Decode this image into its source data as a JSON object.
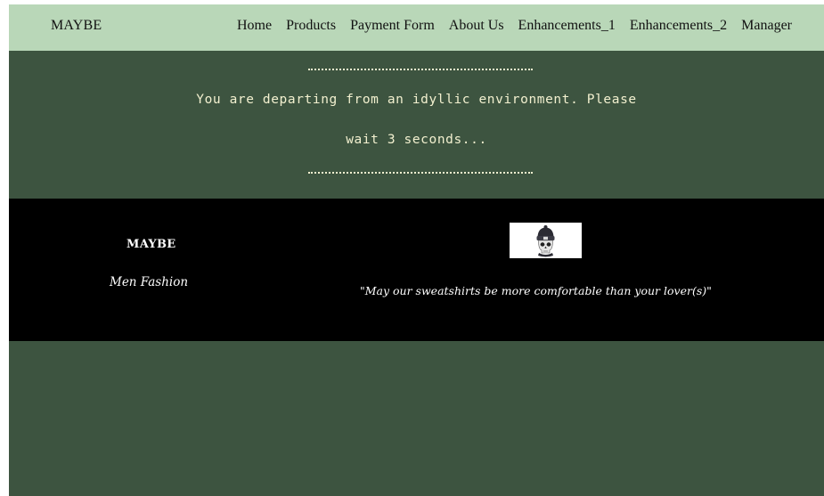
{
  "nav": {
    "brand": "MAYBE",
    "links": [
      {
        "label": "Home"
      },
      {
        "label": "Products"
      },
      {
        "label": "Payment Form"
      },
      {
        "label": "About Us"
      },
      {
        "label": "Enhancements_1"
      },
      {
        "label": "Enhancements_2"
      },
      {
        "label": "Manager"
      }
    ]
  },
  "redirect": {
    "line1": "You are departing from an idyllic environment. Please",
    "line2": "wait 3 seconds..."
  },
  "footer": {
    "brand": "MAYBE",
    "tagline": "Men Fashion",
    "logo_icon": "skull-beanie-logo-icon",
    "quote": "\"May our sweatshirts be more comfortable than your lover(s)\""
  },
  "colors": {
    "nav_background": "#b9d7b8",
    "page_background": "#3d5440",
    "footer_background": "#000000",
    "redirect_text": "#f2f0cf"
  }
}
